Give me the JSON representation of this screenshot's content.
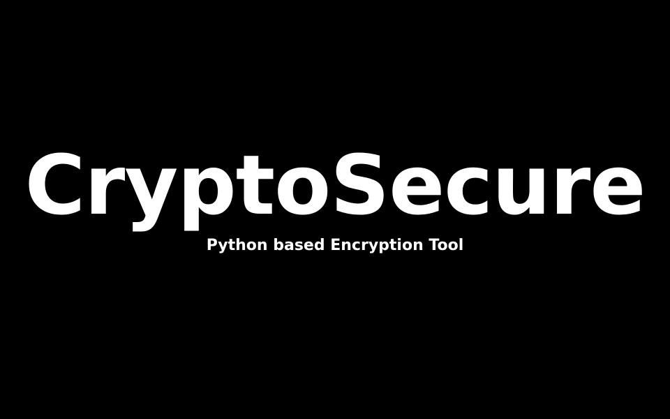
{
  "splash": {
    "title": "CryptoSecure",
    "subtitle": "Python based Encryption Tool"
  },
  "colors": {
    "background": "#000000",
    "text": "#ffffff"
  }
}
